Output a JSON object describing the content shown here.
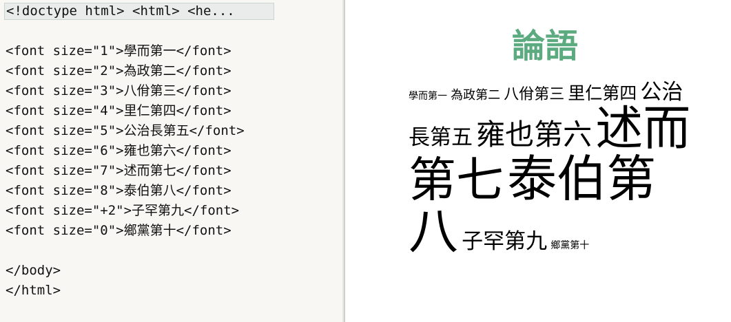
{
  "editor": {
    "collapsed_fold": "<!doctype html> <html> <he...",
    "lines": [
      "<font size=\"1\">學而第一</font>",
      "<font size=\"2\">為政第二</font>",
      "<font size=\"3\">八佾第三</font>",
      "<font size=\"4\">里仁第四</font>",
      "<font size=\"5\">公治長第五</font>",
      "<font size=\"6\">雍也第六</font>",
      "<font size=\"7\">述而第七</font>",
      "<font size=\"8\">泰伯第八</font>",
      "<font size=\"+2\">子罕第九</font>",
      "<font size=\"0\">鄉黨第十</font>",
      "</body>",
      "</html>"
    ]
  },
  "preview": {
    "heading": "論語",
    "heading_color": "#5caa7f",
    "chapters": [
      {
        "text": "學而第一",
        "size": "1"
      },
      {
        "text": "為政第二",
        "size": "2"
      },
      {
        "text": "八佾第三",
        "size": "3"
      },
      {
        "text": "里仁第四",
        "size": "4"
      },
      {
        "text": "公治長第五",
        "size": "5"
      },
      {
        "text": "雍也第六",
        "size": "6"
      },
      {
        "text": "述而第七",
        "size": "7"
      },
      {
        "text": "泰伯第八",
        "size": "8"
      },
      {
        "text": "子罕第九",
        "size": "+2"
      },
      {
        "text": "鄉黨第十",
        "size": "0"
      }
    ]
  }
}
